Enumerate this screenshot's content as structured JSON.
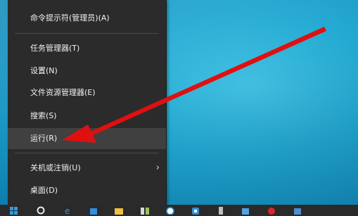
{
  "menu": {
    "items": [
      {
        "label": "命令提示符(管理员)(A)"
      },
      {
        "label": "任务管理器(T)"
      },
      {
        "label": "设置(N)"
      },
      {
        "label": "文件资源管理器(E)"
      },
      {
        "label": "搜索(S)"
      },
      {
        "label": "运行(R)"
      },
      {
        "label": "关机或注销(U)",
        "chevron": "›"
      },
      {
        "label": "桌面(D)"
      }
    ]
  },
  "annotation": {
    "arrow_color": "#e01010"
  },
  "taskbar": {
    "icons": [
      "windows-start-icon",
      "search-icon",
      "edge-browser-icon",
      "store-icon",
      "file-explorer-icon",
      "app-icon",
      "skype-icon",
      "app-icon",
      "app-icon",
      "antivirus-icon",
      "app-icon"
    ]
  }
}
